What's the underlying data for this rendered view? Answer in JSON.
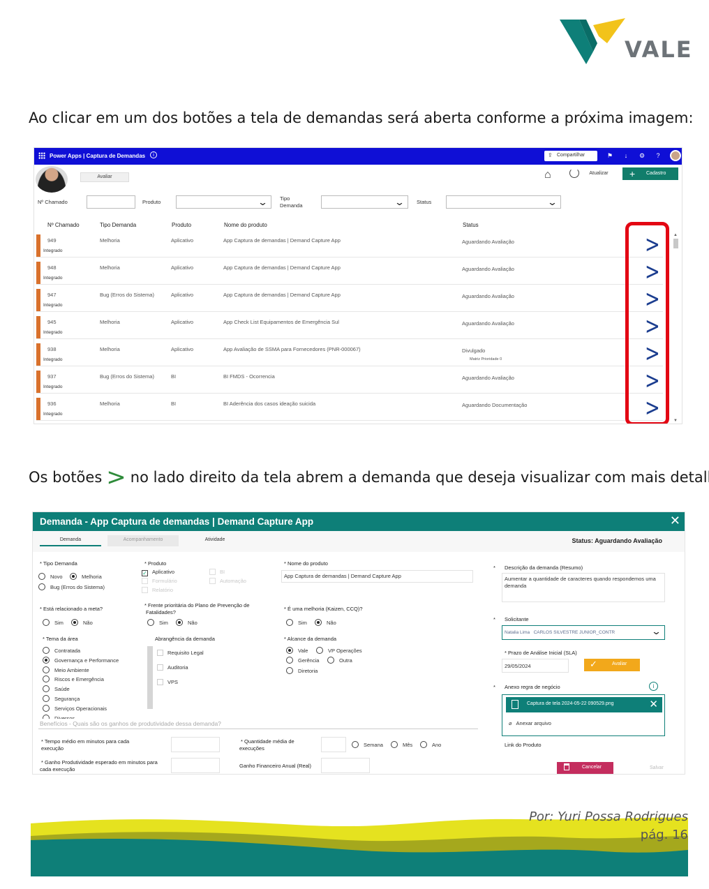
{
  "logo": {
    "text": "VALE"
  },
  "doc": {
    "para1": "Ao clicar em um dos botões a tela de demandas será aberta conforme a próxima imagem:",
    "para2_before": "Os botões",
    "para2_glyph": ">",
    "para2_after": "no lado direito da tela abrem a demanda que deseja visualizar com mais detalhes:"
  },
  "screen1": {
    "app_title": "Power Apps  |  Captura de Demandas",
    "share_label": "Compartilhar",
    "avaliar_label": "Avaliar",
    "atualizar_label": "Atualizar",
    "cadastro_label": "Cadastro",
    "filters": {
      "chamado": "Nº Chamado",
      "produto": "Produto",
      "tipo_line1": "Tipo",
      "tipo_line2": "Demanda",
      "status": "Status"
    },
    "columns": [
      "Nº Chamado",
      "Tipo Demanda",
      "Produto",
      "Nome do produto",
      "Status"
    ],
    "rows": [
      {
        "id": "949",
        "tipo": "Melhoria",
        "produto": "Aplicativo",
        "nome": "App Captura de demandas | Demand Capture App",
        "status": "Aguardando Avaliação",
        "sub": "Integrado",
        "extra": ""
      },
      {
        "id": "948",
        "tipo": "Melhoria",
        "produto": "Aplicativo",
        "nome": "App Captura de demandas | Demand Capture App",
        "status": "Aguardando Avaliação",
        "sub": "Integrado",
        "extra": ""
      },
      {
        "id": "947",
        "tipo": "Bug (Erros do Sistema)",
        "produto": "Aplicativo",
        "nome": "App Captura de demandas | Demand Capture App",
        "status": "Aguardando Avaliação",
        "sub": "Integrado",
        "extra": ""
      },
      {
        "id": "945",
        "tipo": "Melhoria",
        "produto": "Aplicativo",
        "nome": "App Check List Equipamentos de Emergência Sul",
        "status": "Aguardando Avaliação",
        "sub": "Integrado",
        "extra": ""
      },
      {
        "id": "938",
        "tipo": "Melhoria",
        "produto": "Aplicativo",
        "nome": "App Avaliação de SSMA para Fornecedores (PNR-000067)",
        "status": "Divulgado",
        "sub": "Integrado",
        "extra": "Matriz Prioridade 0"
      },
      {
        "id": "937",
        "tipo": "Bug (Erros do Sistema)",
        "produto": "BI",
        "nome": "BI FMDS - Ocorrencia",
        "status": "Aguardando Avaliação",
        "sub": "Integrado",
        "extra": ""
      },
      {
        "id": "936",
        "tipo": "Melhoria",
        "produto": "BI",
        "nome": "BI Aderência dos casos ideação suicida",
        "status": "Aguardando Documentação",
        "sub": "Integrado",
        "extra": ""
      }
    ],
    "row_chevron": ">"
  },
  "screen2": {
    "title": "Demanda - App Captura de demandas | Demand Capture App",
    "tabs": [
      "Demanda",
      "Acompanhamento",
      "Atividade"
    ],
    "status": "Status: Aguardando Avaliação",
    "tipo_demanda": {
      "label": "* Tipo Demanda",
      "opt1": "Novo",
      "opt2": "Melhoria",
      "opt3": "Bug (Erros do Sistema)"
    },
    "produto": {
      "label": "* Produto",
      "aplicativo": "Aplicativo",
      "bi": "BI",
      "formulario": "Formulário",
      "automacao": "Automação",
      "relatorio": "Relatório"
    },
    "nome_produto": {
      "label": "* Nome do produto",
      "value": "App Captura de demandas | Demand Capture App"
    },
    "descricao": {
      "star": "*",
      "label": "Descrição da demanda (Resumo)",
      "value": "Aumentar a quantidade de caracteres quando respondemos uma demanda"
    },
    "meta": {
      "label": "* Está relacionado a meta?",
      "sim": "Sim",
      "nao": "Não"
    },
    "frente": {
      "label1": "* Frente prioritária do Plano de Prevenção de",
      "label2": "Fatalidades?",
      "sim": "Sim",
      "nao": "Não"
    },
    "melhoria": {
      "label": "* É uma melhoria (Kaizen, CCQ)?",
      "sim": "Sim",
      "nao": "Não"
    },
    "solicitante": {
      "star": "*",
      "label": "Solicitante",
      "value1": "Natalia Lima",
      "value2": "CARLOS SILVESTRE JUNIOR_CONTR"
    },
    "tema": {
      "label": "* Tema da área",
      "items": [
        "Contratada",
        "Governança e Performance",
        "Meio Ambiente",
        "Riscos e Emergência",
        "Saúde",
        "Segurança",
        "Serviços Operacionais",
        "Diversos"
      ]
    },
    "abrangencia": {
      "label": "Abrangência da demanda",
      "items": [
        "Requisito Legal",
        "Auditoria",
        "VPS"
      ]
    },
    "alcance": {
      "label": "* Alcance da demanda",
      "vale": "Vale",
      "vp": "VP Operações",
      "gerencia": "Gerência",
      "outra": "Outra",
      "diretoria": "Diretoria"
    },
    "prazo": {
      "label": "* Prazo de Análise Inicial (SLA)",
      "value": "29/05/2024",
      "avaliar": "Avaliar"
    },
    "anexo": {
      "star": "*",
      "label": "Anexo regra de negócio",
      "info": "i",
      "file": "Captura de tela 2024-05-22 090529.png",
      "anexar": "Anexar arquivo"
    },
    "beneficios_placeholder": "Benefícios - Quais são os ganhos de produtividade dessa demanda?",
    "tempo_medio": {
      "line1": "* Tempo médio em minutos para cada",
      "line2": "execução"
    },
    "quantidade": {
      "line1": "* Quantidade média de",
      "line2": "execuções",
      "semana": "Semana",
      "mes": "Mês",
      "ano": "Ano"
    },
    "ganho": {
      "line1": "* Ganho Produtividade esperado em minutos para",
      "line2": "cada execução"
    },
    "ganho_fin": "Ganho Financeiro Anual (Real)",
    "link": "Link do Produto",
    "cancelar": "Cancelar",
    "salvar": "Salvar"
  },
  "footer": {
    "author": "Por: Yuri Possa Rodrigues",
    "page": "pág. 16"
  },
  "colors": {
    "brand_teal": "#0e7f78",
    "brand_yellow": "#f2c31b",
    "powerapps_bar": "#0f0fd6",
    "highlight_red": "#e30613"
  }
}
